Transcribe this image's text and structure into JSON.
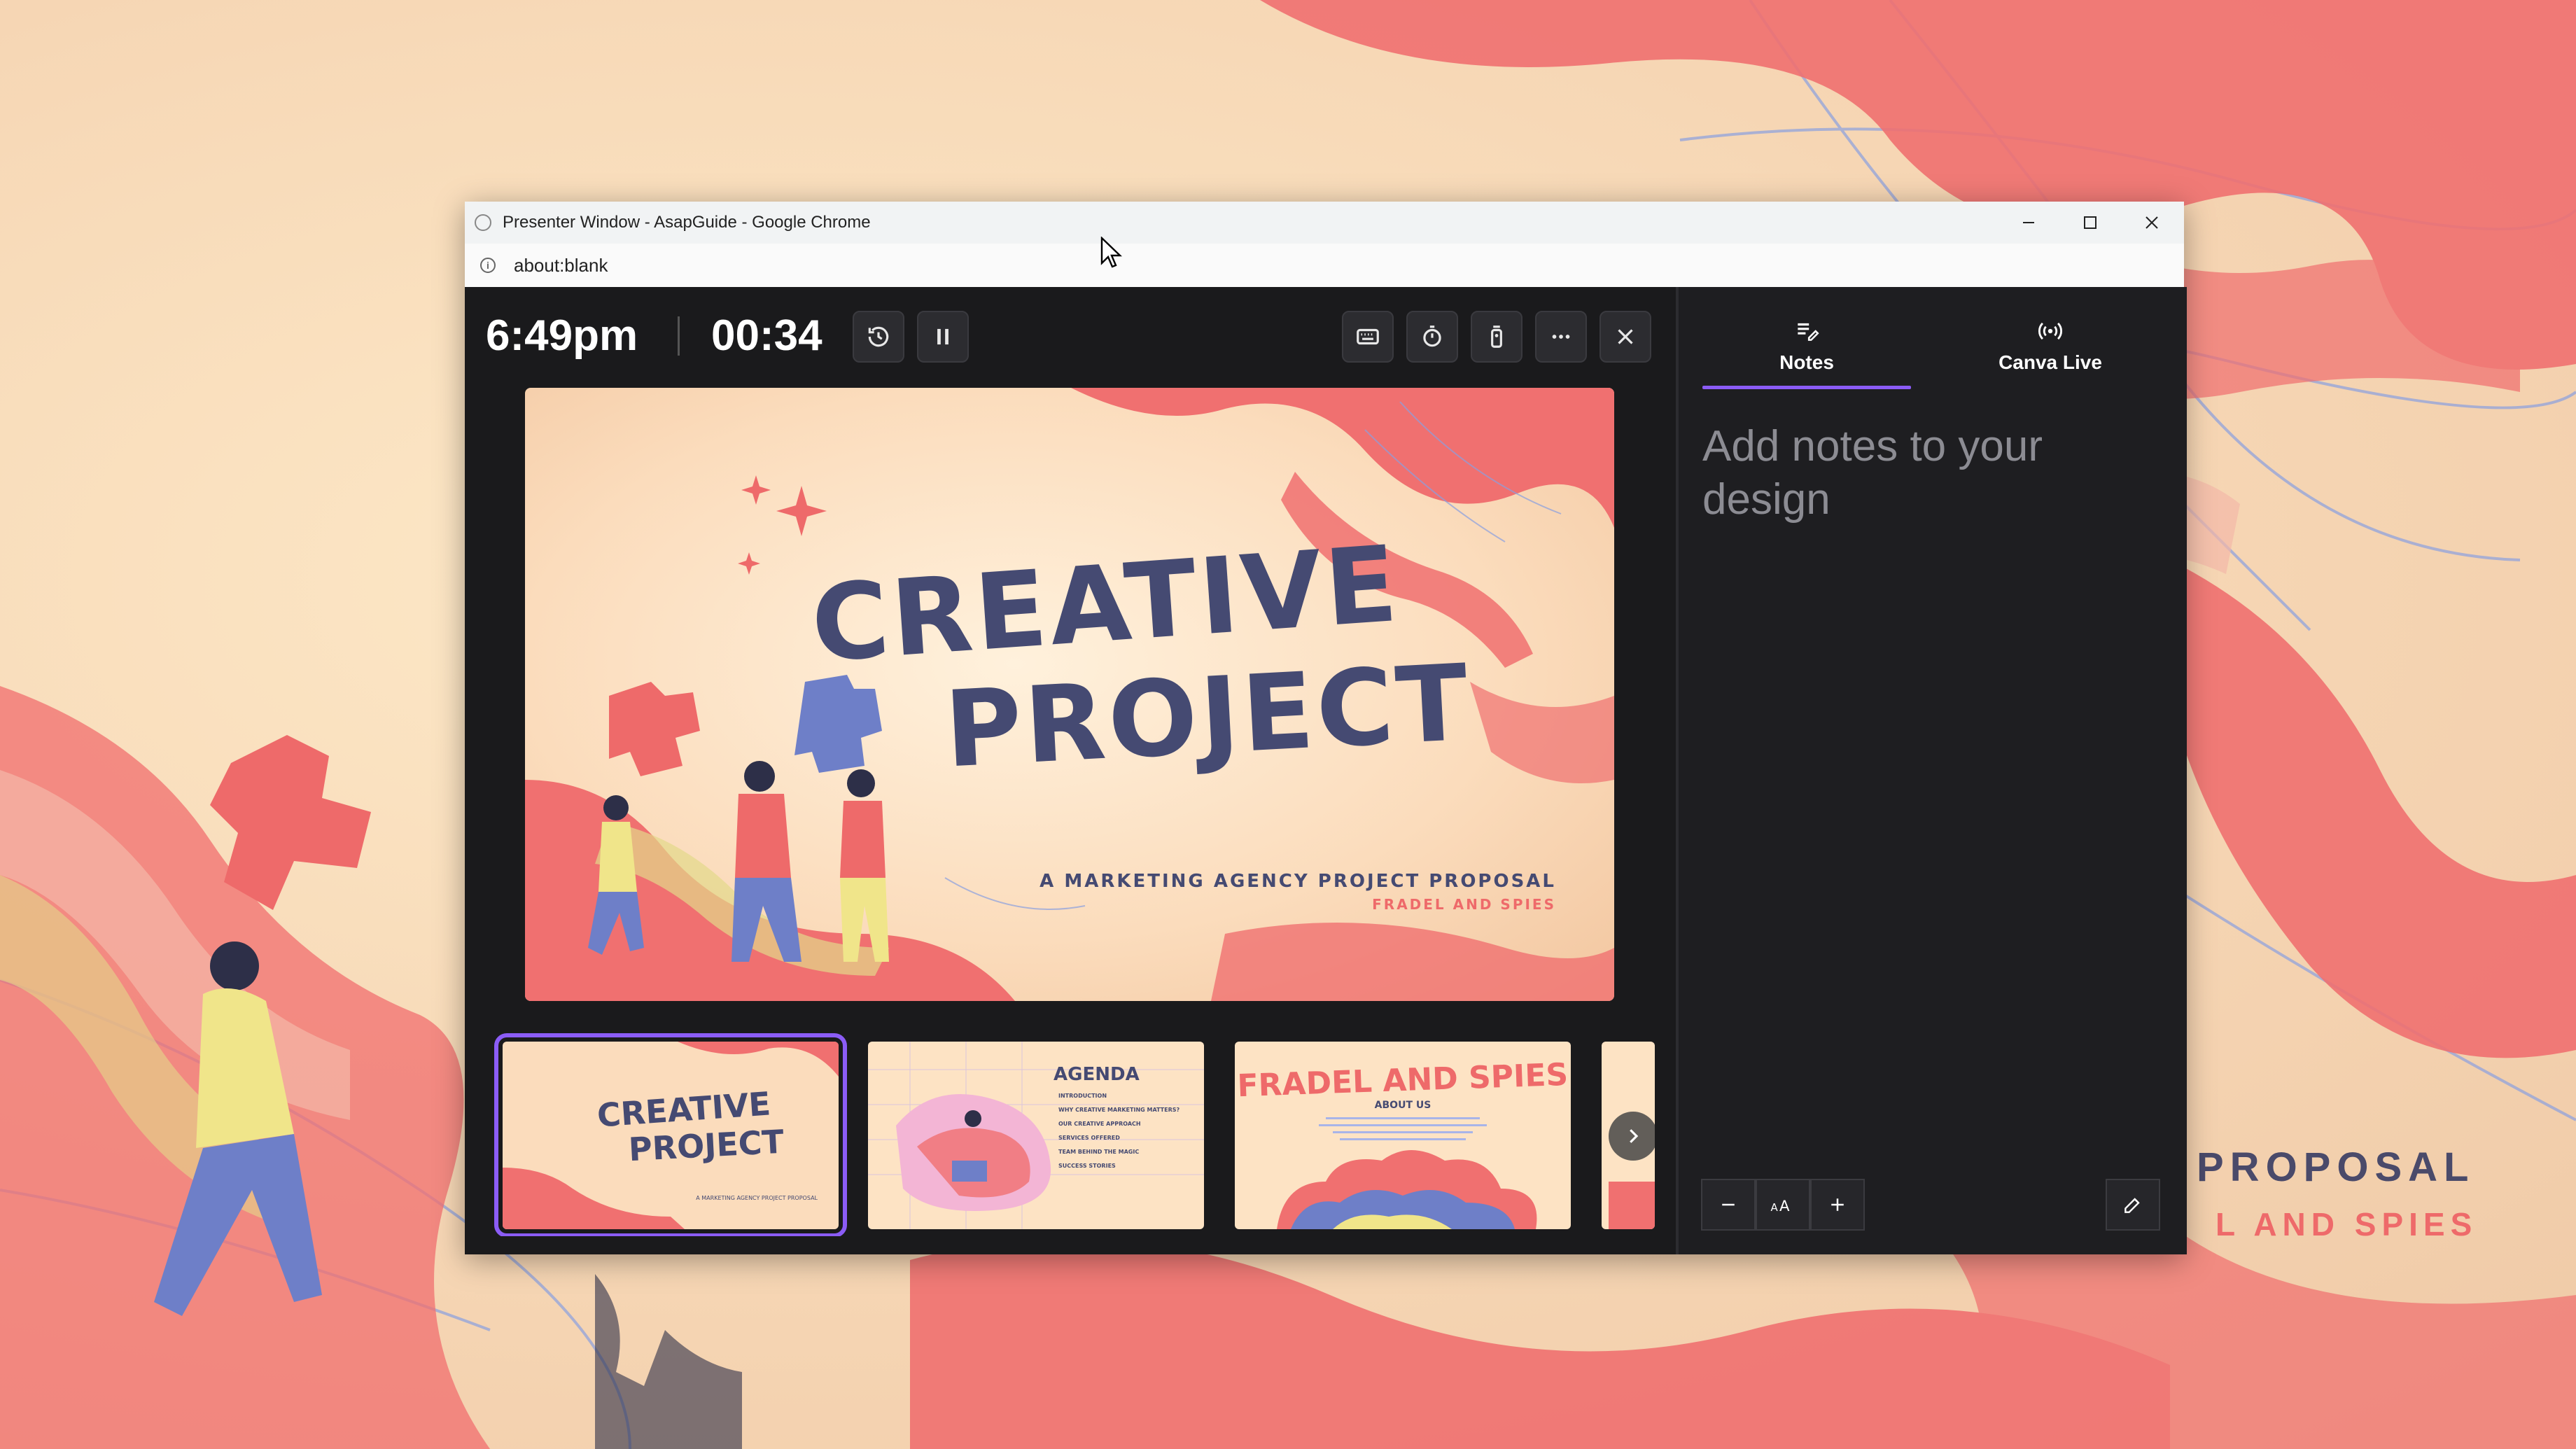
{
  "background": {
    "line1": "PROPOSAL",
    "line2": "L AND SPIES"
  },
  "window": {
    "title": "Presenter Window - AsapGuide - Google Chrome",
    "url": "about:blank"
  },
  "presenter": {
    "clock": "6:49pm",
    "timer": "00:34",
    "slide": {
      "title_line1": "CREATIVE",
      "title_line2": "PROJECT",
      "subtitle": "A MARKETING AGENCY PROJECT PROPOSAL",
      "author": "FRADEL AND SPIES"
    },
    "thumbnails": [
      {
        "title_line1": "CREATIVE",
        "title_line2": "PROJECT",
        "caption": "A MARKETING AGENCY PROJECT PROPOSAL",
        "selected": true
      },
      {
        "title": "AGENDA",
        "items": [
          "INTRODUCTION",
          "WHY CREATIVE MARKETING MATTERS?",
          "OUR CREATIVE APPROACH",
          "SERVICES OFFERED",
          "TEAM BEHIND THE MAGIC",
          "SUCCESS STORIES"
        ],
        "selected": false
      },
      {
        "title": "FRADEL AND SPIES",
        "subtitle": "ABOUT US",
        "selected": false
      }
    ]
  },
  "sidepanel": {
    "tabs": [
      {
        "label": "Notes",
        "icon": "notes-icon",
        "active": true
      },
      {
        "label": "Canva Live",
        "icon": "broadcast-icon",
        "active": false
      }
    ],
    "notes_placeholder": "Add notes to your design"
  },
  "colors": {
    "accent": "#8b5cf6",
    "panel_bg": "#1e1e21",
    "slide_coral": "#ee6a6a",
    "slide_navy": "#454a72"
  }
}
